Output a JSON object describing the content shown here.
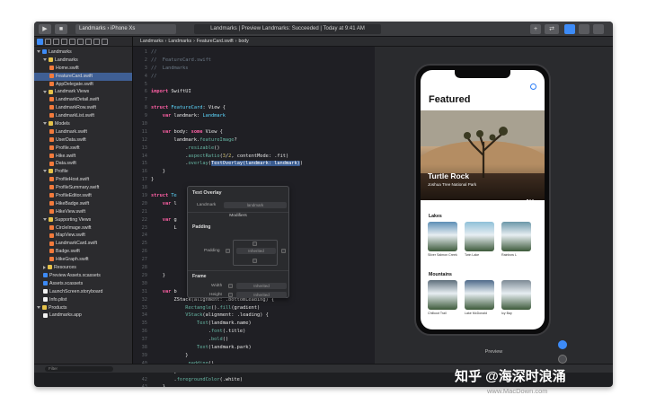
{
  "toolbar": {
    "scheme_app": "Landmarks",
    "scheme_device": "iPhone Xs",
    "status": "Landmarks | Preview Landmarks: Succeeded | Today at 9:41 AM"
  },
  "navigator": {
    "filter_placeholder": "Filter",
    "items": [
      {
        "label": "Landmarks",
        "indent": 0,
        "kind": "blue",
        "open": true
      },
      {
        "label": "Landmarks",
        "indent": 1,
        "kind": "folder",
        "open": true
      },
      {
        "label": "Home.swift",
        "indent": 2,
        "kind": "swift"
      },
      {
        "label": "FeatureCard.swift",
        "indent": 2,
        "kind": "swift",
        "selected": true
      },
      {
        "label": "AppDelegate.swift",
        "indent": 2,
        "kind": "swift"
      },
      {
        "label": "Landmark Views",
        "indent": 1,
        "kind": "folder",
        "open": true
      },
      {
        "label": "LandmarkDetail.swift",
        "indent": 2,
        "kind": "swift"
      },
      {
        "label": "LandmarkRow.swift",
        "indent": 2,
        "kind": "swift"
      },
      {
        "label": "LandmarkList.swift",
        "indent": 2,
        "kind": "swift"
      },
      {
        "label": "Models",
        "indent": 1,
        "kind": "folder",
        "open": true
      },
      {
        "label": "Landmark.swift",
        "indent": 2,
        "kind": "swift"
      },
      {
        "label": "UserData.swift",
        "indent": 2,
        "kind": "swift"
      },
      {
        "label": "Profile.swift",
        "indent": 2,
        "kind": "swift"
      },
      {
        "label": "Hike.swift",
        "indent": 2,
        "kind": "swift"
      },
      {
        "label": "Data.swift",
        "indent": 2,
        "kind": "swift"
      },
      {
        "label": "Profile",
        "indent": 1,
        "kind": "folder",
        "open": true
      },
      {
        "label": "ProfileHost.swift",
        "indent": 2,
        "kind": "swift"
      },
      {
        "label": "ProfileSummary.swift",
        "indent": 2,
        "kind": "swift"
      },
      {
        "label": "ProfileEditor.swift",
        "indent": 2,
        "kind": "swift"
      },
      {
        "label": "HikeBadge.swift",
        "indent": 2,
        "kind": "swift"
      },
      {
        "label": "HikeView.swift",
        "indent": 2,
        "kind": "swift"
      },
      {
        "label": "Supporting Views",
        "indent": 1,
        "kind": "folder",
        "open": true
      },
      {
        "label": "CircleImage.swift",
        "indent": 2,
        "kind": "swift"
      },
      {
        "label": "MapView.swift",
        "indent": 2,
        "kind": "swift"
      },
      {
        "label": "LandmarkCard.swift",
        "indent": 2,
        "kind": "swift"
      },
      {
        "label": "Badge.swift",
        "indent": 2,
        "kind": "swift"
      },
      {
        "label": "HikeGraph.swift",
        "indent": 2,
        "kind": "swift"
      },
      {
        "label": "Resources",
        "indent": 1,
        "kind": "folder",
        "open": false
      },
      {
        "label": "Preview Assets.xcassets",
        "indent": 1,
        "kind": "blue"
      },
      {
        "label": "Assets.xcassets",
        "indent": 1,
        "kind": "blue"
      },
      {
        "label": "LaunchScreen.storyboard",
        "indent": 1,
        "kind": "file"
      },
      {
        "label": "Info.plist",
        "indent": 1,
        "kind": "file"
      },
      {
        "label": "Products",
        "indent": 0,
        "kind": "folder",
        "open": true
      },
      {
        "label": "Landmarks.app",
        "indent": 1,
        "kind": "file"
      }
    ]
  },
  "editor": {
    "breadcrumb": [
      "Landmarks",
      "Landmarks",
      "FeatureCard.swift",
      "body"
    ],
    "code": [
      {
        "n": "1",
        "parts": [
          [
            "c-comment",
            "//"
          ]
        ]
      },
      {
        "n": "2",
        "parts": [
          [
            "c-comment",
            "//  FeatureCard.swift"
          ]
        ]
      },
      {
        "n": "3",
        "parts": [
          [
            "c-comment",
            "//  Landmarks"
          ]
        ]
      },
      {
        "n": "4",
        "parts": [
          [
            "c-comment",
            "//"
          ]
        ]
      },
      {
        "n": "5",
        "parts": []
      },
      {
        "n": "6",
        "parts": [
          [
            "c-keyword",
            "import"
          ],
          [
            "c-plain",
            " SwiftUI"
          ]
        ]
      },
      {
        "n": "7",
        "parts": []
      },
      {
        "n": "8",
        "parts": [
          [
            "c-keyword",
            "struct"
          ],
          [
            "c-plain",
            " "
          ],
          [
            "c-type",
            "FeatureCard"
          ],
          [
            "c-plain",
            ": View {"
          ]
        ]
      },
      {
        "n": "9",
        "parts": [
          [
            "c-plain",
            "    "
          ],
          [
            "c-keyword",
            "var"
          ],
          [
            "c-plain",
            " landmark: "
          ],
          [
            "c-type",
            "Landmark"
          ]
        ]
      },
      {
        "n": "10",
        "parts": []
      },
      {
        "n": "11",
        "parts": [
          [
            "c-plain",
            "    "
          ],
          [
            "c-keyword",
            "var"
          ],
          [
            "c-plain",
            " body: "
          ],
          [
            "c-keyword",
            "some"
          ],
          [
            "c-plain",
            " View {"
          ]
        ]
      },
      {
        "n": "12",
        "parts": [
          [
            "c-plain",
            "        landmark."
          ],
          [
            "c-func",
            "featureImage"
          ],
          [
            "c-plain",
            "?"
          ]
        ]
      },
      {
        "n": "13",
        "parts": [
          [
            "c-plain",
            "            ."
          ],
          [
            "c-func",
            "resizable"
          ],
          [
            "c-plain",
            "()"
          ]
        ]
      },
      {
        "n": "14",
        "parts": [
          [
            "c-plain",
            "            ."
          ],
          [
            "c-func",
            "aspectRatio"
          ],
          [
            "c-plain",
            "("
          ],
          [
            "c-num",
            "3"
          ],
          [
            "c-plain",
            "/"
          ],
          [
            "c-num",
            "2"
          ],
          [
            "c-plain",
            ", contentMode: .fit)"
          ]
        ]
      },
      {
        "n": "15",
        "parts": [
          [
            "c-plain",
            "            ."
          ],
          [
            "c-func",
            "overlay"
          ],
          [
            "c-plain",
            "("
          ],
          [
            "hl",
            "TextOverlay(landmark: landmark)"
          ],
          [
            "c-plain",
            ")"
          ]
        ]
      },
      {
        "n": "16",
        "parts": [
          [
            "c-plain",
            "    }"
          ]
        ]
      },
      {
        "n": "17",
        "parts": [
          [
            "c-plain",
            "}"
          ]
        ]
      },
      {
        "n": "18",
        "parts": []
      },
      {
        "n": "19",
        "parts": [
          [
            "c-keyword",
            "struct"
          ],
          [
            "c-plain",
            " "
          ],
          [
            "c-type",
            "Te"
          ]
        ]
      },
      {
        "n": "20",
        "parts": [
          [
            "c-plain",
            "    "
          ],
          [
            "c-keyword",
            "var"
          ],
          [
            "c-plain",
            " l"
          ]
        ]
      },
      {
        "n": "21",
        "parts": []
      },
      {
        "n": "22",
        "parts": [
          [
            "c-plain",
            "    "
          ],
          [
            "c-keyword",
            "var"
          ],
          [
            "c-plain",
            " g"
          ]
        ]
      },
      {
        "n": "23",
        "parts": [
          [
            "c-plain",
            "        L"
          ]
        ]
      },
      {
        "n": "24",
        "parts": []
      },
      {
        "n": "25",
        "parts": []
      },
      {
        "n": "26",
        "parts": []
      },
      {
        "n": "27",
        "parts": []
      },
      {
        "n": "28",
        "parts": []
      },
      {
        "n": "29",
        "parts": [
          [
            "c-plain",
            "    }"
          ]
        ]
      },
      {
        "n": "30",
        "parts": []
      },
      {
        "n": "31",
        "parts": [
          [
            "c-plain",
            "    "
          ],
          [
            "c-keyword",
            "var"
          ],
          [
            "c-plain",
            " b"
          ]
        ]
      },
      {
        "n": "32",
        "parts": [
          [
            "c-plain",
            "        ZStack(alignment: .bottomLeading) {"
          ]
        ]
      },
      {
        "n": "33",
        "parts": [
          [
            "c-plain",
            "            "
          ],
          [
            "c-func",
            "Rectangle"
          ],
          [
            "c-plain",
            "()."
          ],
          [
            "c-func",
            "fill"
          ],
          [
            "c-plain",
            "(gradient)"
          ]
        ]
      },
      {
        "n": "34",
        "parts": [
          [
            "c-plain",
            "            "
          ],
          [
            "c-func",
            "VStack"
          ],
          [
            "c-plain",
            "(alignment: .leading) {"
          ]
        ]
      },
      {
        "n": "35",
        "parts": [
          [
            "c-plain",
            "                "
          ],
          [
            "c-func",
            "Text"
          ],
          [
            "c-plain",
            "(landmark.name)"
          ]
        ]
      },
      {
        "n": "36",
        "parts": [
          [
            "c-plain",
            "                    ."
          ],
          [
            "c-func",
            "font"
          ],
          [
            "c-plain",
            "(.title)"
          ]
        ]
      },
      {
        "n": "37",
        "parts": [
          [
            "c-plain",
            "                    ."
          ],
          [
            "c-func",
            "bold"
          ],
          [
            "c-plain",
            "()"
          ]
        ]
      },
      {
        "n": "38",
        "parts": [
          [
            "c-plain",
            "                "
          ],
          [
            "c-func",
            "Text"
          ],
          [
            "c-plain",
            "(landmark.park)"
          ]
        ]
      },
      {
        "n": "39",
        "parts": [
          [
            "c-plain",
            "            }"
          ]
        ]
      },
      {
        "n": "40",
        "parts": [
          [
            "c-plain",
            "            ."
          ],
          [
            "c-func",
            "padding"
          ],
          [
            "c-plain",
            "()"
          ]
        ]
      },
      {
        "n": "41",
        "parts": [
          [
            "c-plain",
            "        }"
          ]
        ]
      },
      {
        "n": "42",
        "parts": [
          [
            "c-plain",
            "        ."
          ],
          [
            "c-func",
            "foregroundColor"
          ],
          [
            "c-plain",
            "(.white)"
          ]
        ]
      },
      {
        "n": "43",
        "parts": [
          [
            "c-plain",
            "    }"
          ]
        ]
      },
      {
        "n": "44",
        "parts": [
          [
            "c-plain",
            "}"
          ]
        ]
      }
    ]
  },
  "inspector": {
    "title": "Text Overlay",
    "landmark_label": "Landmark",
    "landmark_value": "landmark",
    "modifiers_label": "Modifiers",
    "padding_section": "Padding",
    "padding_label": "Padding",
    "padding_value": "Inherited",
    "frame_section": "Frame",
    "width_label": "Width",
    "width_value": "Inherited",
    "height_label": "Height",
    "height_value": "Inherited"
  },
  "preview": {
    "nav_title": "Featured",
    "hero_title": "Turtle Rock",
    "hero_subtitle": "Joshua Tree National Park",
    "categories": [
      {
        "name": "Lakes",
        "items": [
          "Silver Salmon Creek",
          "Twin Lake",
          "Rainbow L"
        ]
      },
      {
        "name": "Mountains",
        "items": [
          "Chilkoot Trail",
          "Lake McDonald",
          "Icy Bay"
        ]
      }
    ],
    "label": "Preview"
  },
  "watermark": {
    "line1": "知乎 @海深时浪涌",
    "line2": "www.MacDown.com"
  },
  "colors": {
    "accent": "#3d8bf7",
    "editor_bg": "#1f1f24",
    "keyword": "#fc5fa3"
  }
}
